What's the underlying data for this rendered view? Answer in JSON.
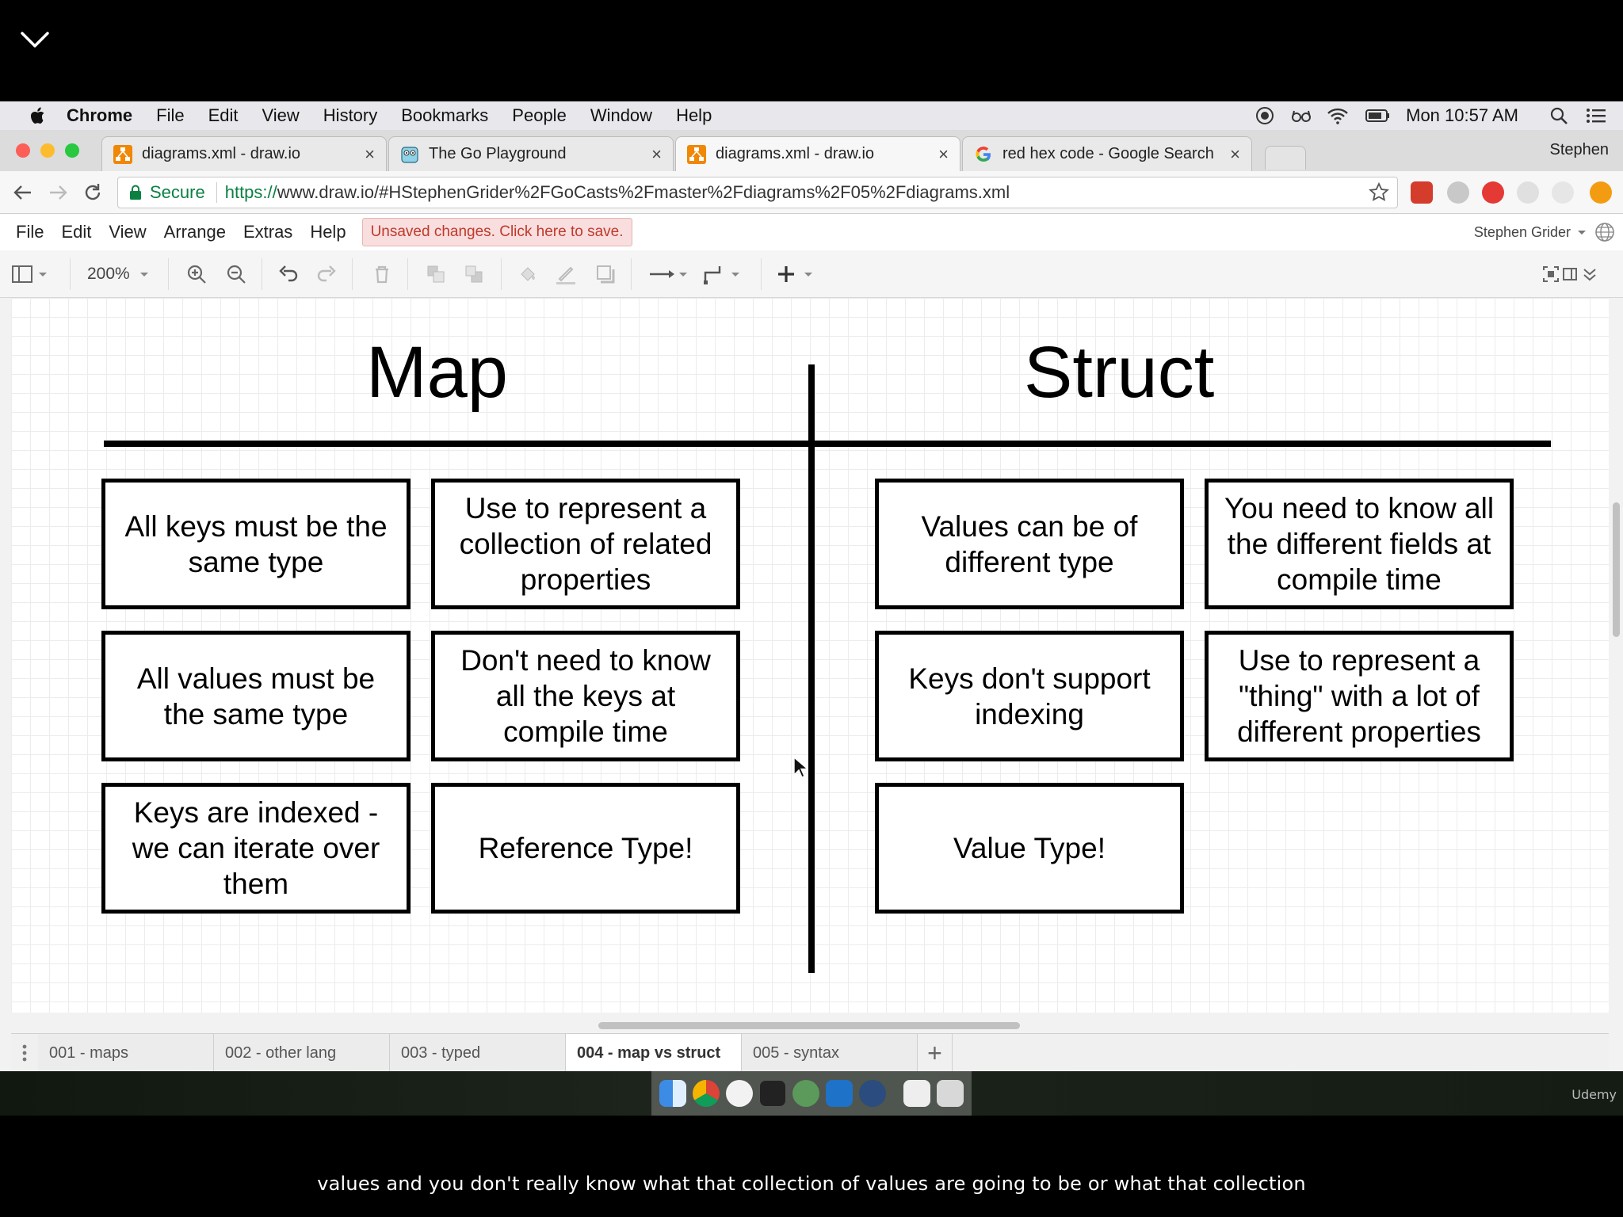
{
  "menubar": {
    "items": [
      "Chrome",
      "File",
      "Edit",
      "View",
      "History",
      "Bookmarks",
      "People",
      "Window",
      "Help"
    ],
    "clock": "Mon 10:57 AM"
  },
  "tabs": [
    {
      "title": "diagrams.xml - draw.io",
      "icon": "drawio-icon"
    },
    {
      "title": "The Go Playground",
      "icon": "gopher-icon"
    },
    {
      "title": "diagrams.xml - draw.io",
      "icon": "drawio-icon"
    },
    {
      "title": "red hex code - Google Search",
      "icon": "google-icon"
    }
  ],
  "profile": "Stephen",
  "address": {
    "secure_label": "Secure",
    "url_scheme": "https://",
    "url_rest": "www.draw.io/#HStephenGrider%2FGoCasts%2Fmaster%2Fdiagrams%2F05%2Fdiagrams.xml"
  },
  "drawio_menu": {
    "items": [
      "File",
      "Edit",
      "View",
      "Arrange",
      "Extras",
      "Help"
    ],
    "unsaved": "Unsaved changes. Click here to save.",
    "user": "Stephen Grider"
  },
  "toolbar": {
    "zoom": "200%"
  },
  "diagram": {
    "left_title": "Map",
    "right_title": "Struct",
    "map_cards": [
      "All keys must be the same type",
      "Use to represent a collection of related properties",
      "All values must be the same type",
      "Don't need to know all the keys at compile time",
      "Keys are indexed - we can iterate over them",
      "Reference Type!"
    ],
    "struct_cards": [
      "Values can be of different type",
      "You need to know all the different fields at compile time",
      "Keys don't support indexing",
      "Use to represent a \"thing\" with a lot of different properties",
      "Value Type!"
    ]
  },
  "pages": [
    "001 - maps",
    "002 - other lang",
    "003 - typed",
    "004 - map vs struct",
    "005 - syntax"
  ],
  "active_page": "004 - map vs struct",
  "watermark": "Udemy",
  "subtitle": "values and you don't really know what that collection of values are going to be or what that collection",
  "colors": {
    "unsaved_text": "#c0392b",
    "secure_green": "#0b8043",
    "drawio_orange": "#f08705"
  }
}
